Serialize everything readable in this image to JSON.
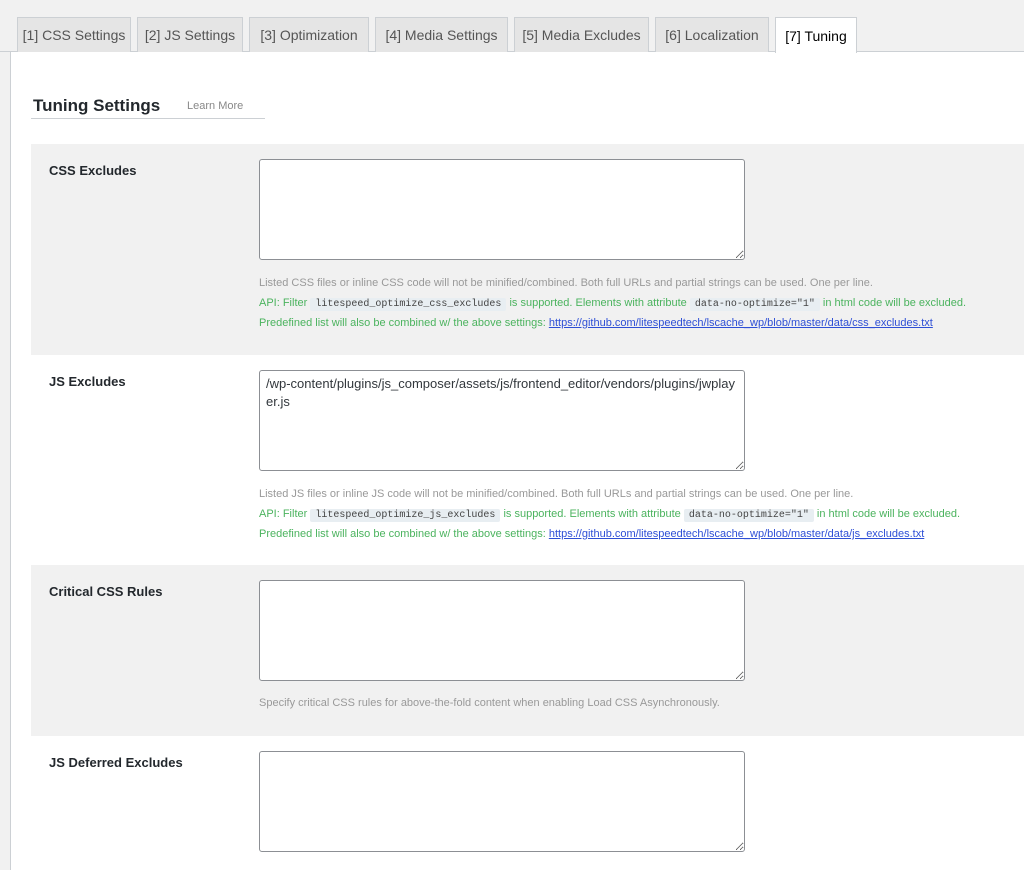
{
  "tabs": [
    {
      "label": "[1] CSS Settings",
      "active": false
    },
    {
      "label": "[2] JS Settings",
      "active": false
    },
    {
      "label": "[3] Optimization",
      "active": false
    },
    {
      "label": "[4] Media Settings",
      "active": false
    },
    {
      "label": "[5] Media Excludes",
      "active": false
    },
    {
      "label": "[6] Localization",
      "active": false
    },
    {
      "label": "[7] Tuning",
      "active": true
    }
  ],
  "header": {
    "title": "Tuning Settings",
    "learn_more": "Learn More"
  },
  "css_excludes": {
    "label": "CSS Excludes",
    "value": "",
    "desc1": "Listed CSS files or inline CSS code will not be minified/combined. Both full URLs and partial strings can be used. One per line.",
    "api_prefix": "API: Filter",
    "filter_code": "litespeed_optimize_css_excludes",
    "api_mid": "is supported. Elements with attribute",
    "attr_code": "data-no-optimize=\"1\"",
    "api_suffix": "in html code will be excluded.",
    "predefined_prefix": "Predefined list will also be combined w/ the above settings:",
    "link": "https://github.com/litespeedtech/lscache_wp/blob/master/data/css_excludes.txt"
  },
  "js_excludes": {
    "label": "JS Excludes",
    "value": "/wp-content/plugins/js_composer/assets/js/frontend_editor/vendors/plugins/jwplayer.js",
    "desc1": "Listed JS files or inline JS code will not be minified/combined. Both full URLs and partial strings can be used. One per line.",
    "api_prefix": "API: Filter",
    "filter_code": "litespeed_optimize_js_excludes",
    "api_mid": "is supported. Elements with attribute",
    "attr_code": "data-no-optimize=\"1\"",
    "api_suffix": "in html code will be excluded.",
    "predefined_prefix": "Predefined list will also be combined w/ the above settings:",
    "link": "https://github.com/litespeedtech/lscache_wp/blob/master/data/js_excludes.txt"
  },
  "critical_css": {
    "label": "Critical CSS Rules",
    "value": "",
    "desc1": "Specify critical CSS rules for above-the-fold content when enabling Load CSS Asynchronously."
  },
  "js_deferred": {
    "label": "JS Deferred Excludes",
    "value": ""
  }
}
